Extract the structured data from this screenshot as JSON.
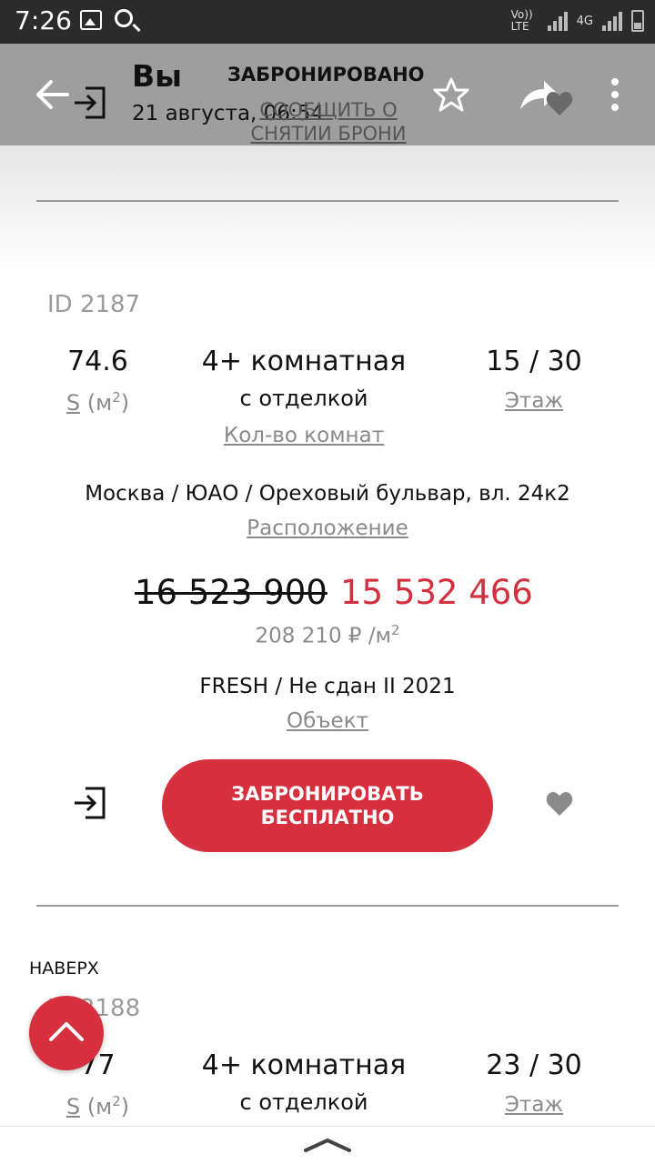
{
  "status_bar": {
    "time": "7:26",
    "network": "Vo)) LTE",
    "network_type": "4G",
    "icons": [
      "gallery-icon",
      "search-icon",
      "signal-icon",
      "wifi-icon",
      "battery-icon"
    ]
  },
  "header": {
    "title": "Вы",
    "date": "21 августа, 06:54",
    "booked_label": "ЗАБРОНИРОВАНО",
    "cancel_link": "СООБЩИТЬ О СНЯТИИ БРОНИ",
    "icons": [
      "back-arrow-icon",
      "login-icon",
      "star-icon",
      "share-icon",
      "heart-icon",
      "more-vert-icon"
    ]
  },
  "listings": [
    {
      "id_label": "ID 2187",
      "area_value": "74.6",
      "area_label_s": "S",
      "area_label_unit": "(м",
      "area_label_sup": "2",
      "area_label_close": ")",
      "rooms_value": "4+ комнатная",
      "rooms_sub": "с отделкой",
      "rooms_label": "Кол-во комнат",
      "floor_value": "15 / 30",
      "floor_label": "Этаж",
      "address": "Москва / ЮАО / Ореховый бульвар, вл. 24к2",
      "address_label": "Расположение",
      "price_old": "16 523 900",
      "price_new": "15 532 466",
      "price_per_m2": "208 210 ₽ /м",
      "price_per_m2_sup": "2",
      "object": "FRESH / Не сдан II 2021",
      "object_label": "Объект",
      "book_button_line1": "ЗАБРОНИРОВАТЬ",
      "book_button_line2": "БЕСПЛАТНО"
    },
    {
      "id_label": "ID 2188",
      "area_value": "77",
      "area_label_s": "S",
      "area_label_unit": "(м",
      "area_label_sup": "2",
      "area_label_close": ")",
      "rooms_value": "4+ комнатная",
      "rooms_sub": "с отделкой",
      "floor_value": "23 / 30",
      "floor_label": "Этаж"
    }
  ],
  "scroll_top": {
    "label": "НАВЕРХ"
  },
  "colors": {
    "accent": "#d6303f",
    "header_overlay": "#9e9e9e",
    "status_bar": "#2b2b2b"
  }
}
